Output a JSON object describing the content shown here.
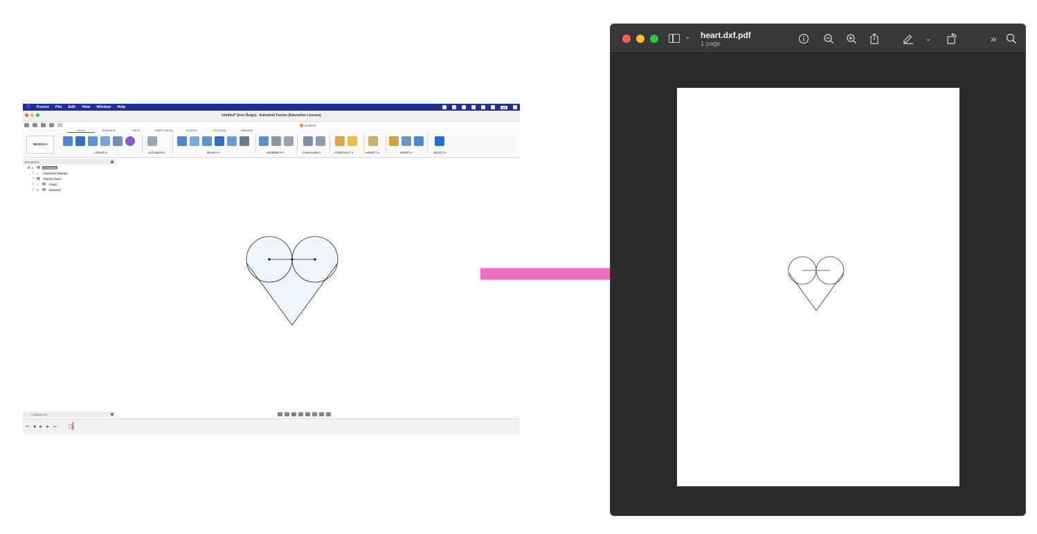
{
  "fusion": {
    "menubar": {
      "app_name": "Fusion",
      "menus": [
        "File",
        "Edit",
        "View",
        "Window",
        "Help"
      ],
      "badge": "US"
    },
    "window_title": "Untitled* (Iron Reign) - Autodesk Fusion (Education License)",
    "doc_tab": "Untitled*",
    "ribbon": {
      "tabs": [
        "SOLID",
        "SURFACE",
        "MESH",
        "SHEET METAL",
        "PLASTIC",
        "UTILITIES",
        "MANAGE"
      ],
      "active_tab": "SOLID",
      "workspace": "DESIGN ▾",
      "groups": [
        "CREATE ▾",
        "AUTOMATE ▾",
        "MODIFY ▾",
        "ASSEMBLE ▾",
        "CONFIGURE ▾",
        "CONSTRUCT ▾",
        "INSPECT ▾",
        "INSERT ▾",
        "SELECT ▾"
      ]
    },
    "browser": {
      "header": "BROWSER",
      "root": "(Unsaved)",
      "items": [
        "Document Settings",
        "Named Views",
        "Origin",
        "Sketches"
      ]
    },
    "comments": "COMMENTS",
    "timeline_controls": [
      "⏮",
      "◀",
      "▶",
      "▶",
      "⏭"
    ]
  },
  "preview": {
    "title": "heart.dxf.pdf",
    "subtitle": "1 page",
    "tool_icons": [
      "info-icon",
      "zoom-out-icon",
      "zoom-in-icon",
      "share-icon",
      "markup-icon",
      "chevron-down-icon",
      "rotate-icon",
      "more-icon",
      "search-icon"
    ]
  },
  "colors": {
    "arrow": "#ee6fc0",
    "menubar": "#1e2e9c",
    "traffic_red": "#ff5f57",
    "traffic_yellow": "#febc2e",
    "traffic_green": "#28c840",
    "heart_fill": "#eef5fb"
  }
}
